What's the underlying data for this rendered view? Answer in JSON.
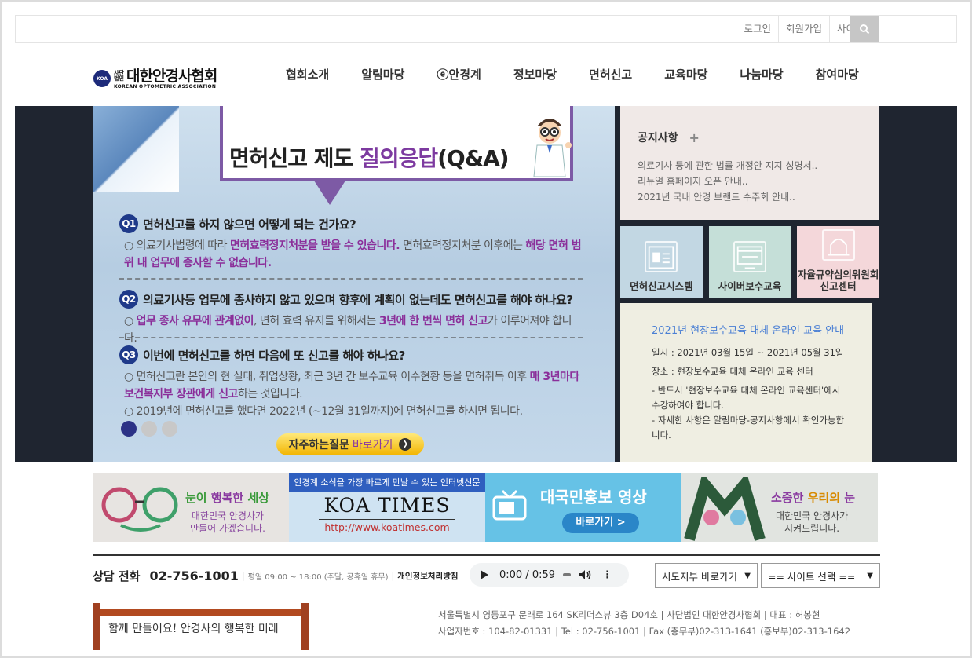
{
  "top_links": [
    "로그인",
    "회원가입",
    "사이트맵"
  ],
  "logo": {
    "mark": "KOA",
    "small": "사단법인",
    "name": "대한안경사협회",
    "eng": "KOREAN OPTOMETRIC ASSOCIATION"
  },
  "nav": [
    "협회소개",
    "알림마당",
    "ⓔ안경계",
    "정보마당",
    "면허신고",
    "교육마당",
    "나눔마당",
    "참여마당"
  ],
  "banner": {
    "title_a": "면허신고 제도 ",
    "title_b": "질의응답",
    "title_c": "(Q&A)",
    "q1_num": "Q1",
    "q1": "면허신고를 하지 않으면 어떻게 되는 건가요?",
    "a1_1": "○ 의료기사법령에 따라 ",
    "a1_2": "면허효력정지처분을 받을 수 있습니다.",
    "a1_3": " 면허효력정지처분 이후에는 ",
    "a1_4": "해당 면허 범위 내 업무에 종사할 수 없습니다.",
    "q2_num": "Q2",
    "q2": "의료기사등 업무에 종사하지 않고 있으며 향후에 계획이 없는데도 면허신고를 해야 하나요?",
    "a2_1": "○ ",
    "a2_2": "업무 종사 유무에 관계없이",
    "a2_3": ", 면허 효력 유지를 위해서는 ",
    "a2_4": "3년에 한 번씩 면허 신고",
    "a2_5": "가 이루어져야 합니다.",
    "q3_num": "Q3",
    "q3": "이번에 면허신고를 하면 다음에 또 신고를 해야 하나요?",
    "a3_1": "○ 면허신고란 본인의 현 실태, 취업상황, 최근 3년 간 보수교육 이수현황 등을 면허취득 이후 ",
    "a3_2": "매 3년마다 보건복지부 장관에게 신고",
    "a3_3": "하는 것입니다.",
    "a3_4": "○ 2019년에 면허신고를 했다면 2022년 (~12월 31일까지)에 면허신고를 하시면 됩니다.",
    "faq_label": "자주하는질문",
    "faq_go": "바로가기",
    "faq_arrow": "❯"
  },
  "notice": {
    "title": "공지사항",
    "plus": "+",
    "items": [
      "의료기사 등에 관한 법률 개정안 지지 성명서..",
      "리뉴얼 홈페이지 오픈 안내..",
      "2021년 국내 안경 브랜드 수주회 안내.."
    ]
  },
  "quick": [
    {
      "label": "면허신고시스템",
      "icon": "id-card-icon"
    },
    {
      "label": "사이버보수교육",
      "icon": "monitor-icon"
    },
    {
      "label": "자율규약심의위원회\n신고센터",
      "icon": "bell-icon"
    }
  ],
  "edu": {
    "title": "2021년 현장보수교육 대체 온라인 교육 안내",
    "date": "일시 : 2021년 03월 15일 ~ 2021년 05월 31일",
    "place": "장소 : 현장보수교육 대체 온라인 교육 센터",
    "note1": "- 반드시 '현장보수교육 대체 온라인 교육센터'에서 수강하여야 합니다.",
    "note2": "- 자세한 사항은 알림마당-공지사항에서 확인가능합니다."
  },
  "ads": {
    "ad1_h_a": "눈이 ",
    "ad1_h_b": "행복한",
    "ad1_h_c": " 세상",
    "ad1_s": "대한민국 안경사가\n만들어 가겠습니다.",
    "ad2_top": "안경계 소식을 가장 빠르게 만날 수 있는 인터넷신문",
    "ad2_brand": "KOA TIMES",
    "ad2_url": "http://www.koatimes.com",
    "ad3_h": "대국민홍보 영상",
    "ad3_btn": "바로가기 >",
    "ad4_h_a": "소중한 ",
    "ad4_h_b": "우리의",
    "ad4_h_c": " 눈",
    "ad4_s": "대한민국 안경사가\n지켜드립니다."
  },
  "footer": {
    "contact_title": "상담 전화",
    "phone": "02-756-1001",
    "hours": "평일 09:00 ~ 18:00 (주말, 공휴일 휴무)",
    "privacy": "개인정보처리방침",
    "player_time": "0:00 / 0:59",
    "select1": "시도지부 바로가기",
    "select2": "== 사이트 선택 ==",
    "slogan": "함께 만들어요! 안경사의 행복한 미래",
    "addr1": "서울특별시 영등포구 문래로 164 SK리더스뷰 3층 D04호 | 사단법인 대한안경사협회 | 대표 : 허봉현",
    "addr2": "사업자번호 : 104-82-01331 | Tel : 02-756-1001 | Fax (총무부)02-313-1641 (홍보부)02-313-1642"
  },
  "colors": {
    "nav_dark": "#1f2530",
    "accent_purple": "#7d3aa0",
    "edu_blue": "#4a7fd4",
    "faq_yellow": "#f2b400"
  }
}
